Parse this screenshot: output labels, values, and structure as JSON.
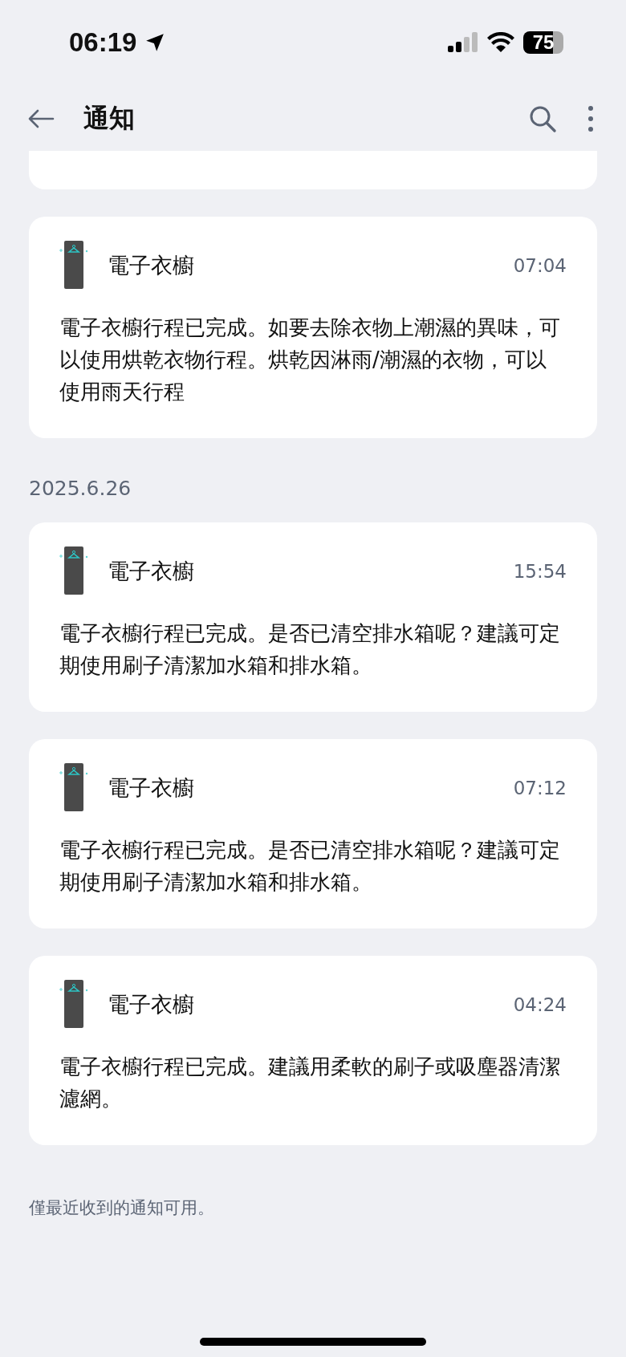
{
  "status_bar": {
    "time": "06:19",
    "battery": "75"
  },
  "header": {
    "title": "通知"
  },
  "sections": [
    {
      "notifications": [
        {
          "source": "電子衣櫥",
          "time": "07:04",
          "message": "電子衣櫥行程已完成。如要去除衣物上潮濕的異味，可以使用烘乾衣物行程。烘乾因淋雨/潮濕的衣物，可以使用雨天行程"
        }
      ]
    },
    {
      "date": "2025.6.26",
      "notifications": [
        {
          "source": "電子衣櫥",
          "time": "15:54",
          "message": "電子衣櫥行程已完成。是否已清空排水箱呢？建議可定期使用刷子清潔加水箱和排水箱。"
        },
        {
          "source": "電子衣櫥",
          "time": "07:12",
          "message": "電子衣櫥行程已完成。是否已清空排水箱呢？建議可定期使用刷子清潔加水箱和排水箱。"
        },
        {
          "source": "電子衣櫥",
          "time": "04:24",
          "message": "電子衣櫥行程已完成。建議用柔軟的刷子或吸塵器清潔濾網。"
        }
      ]
    }
  ],
  "footer": "僅最近收到的通知可用。"
}
